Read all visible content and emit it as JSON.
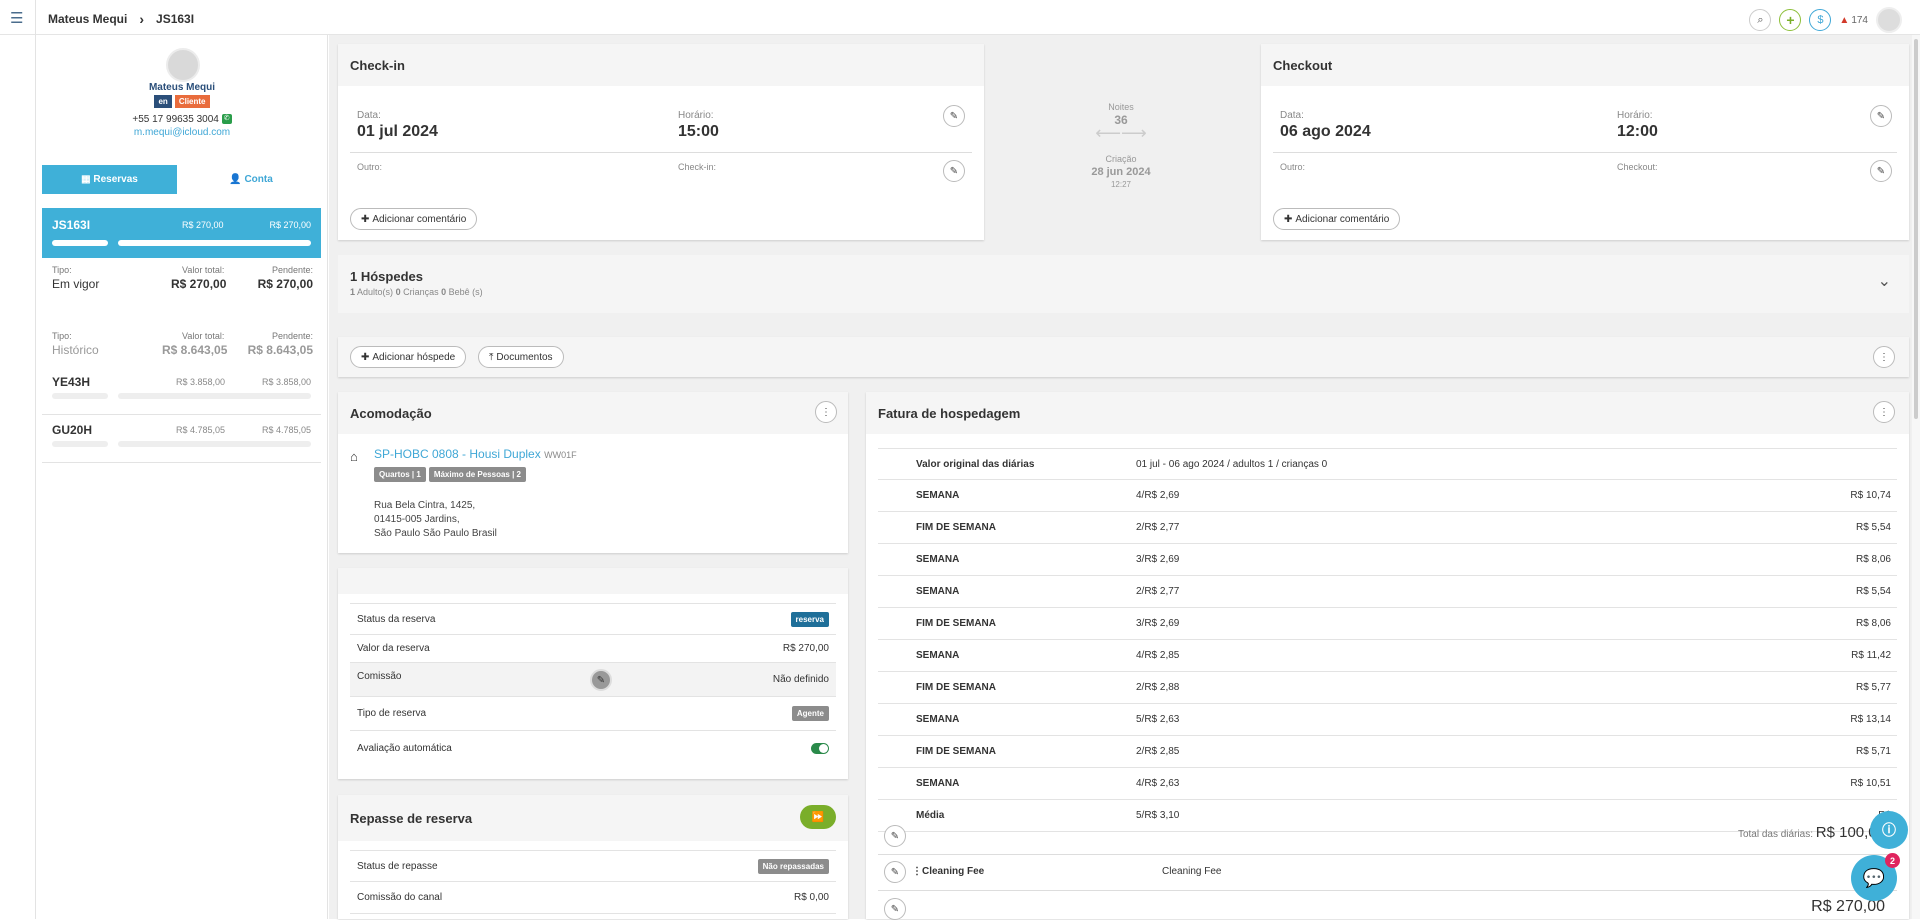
{
  "header": {
    "breadcrumb": [
      "Mateus Mequi",
      "JS163I"
    ],
    "alerts_count": "174"
  },
  "profile": {
    "name": "Mateus Mequi",
    "tags": [
      "en",
      "Cliente"
    ],
    "phone": "+55 17 99635 3004",
    "email": "m.mequi@icloud.com"
  },
  "tabs": {
    "reservas": "Reservas",
    "conta": "Conta"
  },
  "active_reservation": {
    "code": "JS163I",
    "value1": "R$ 270,00",
    "value2": "R$ 270,00",
    "progress1": 1,
    "progress2": 1
  },
  "summary_current": {
    "type_label": "Tipo:",
    "type": "Em vigor",
    "total_label": "Valor total:",
    "total": "R$ 270,00",
    "pending_label": "Pendente:",
    "pending": "R$ 270,00"
  },
  "summary_history": {
    "type_label": "Tipo:",
    "type": "Histórico",
    "total_label": "Valor total:",
    "total": "R$ 8.643,05",
    "pending_label": "Pendente:",
    "pending": "R$ 8.643,05"
  },
  "history_items": [
    {
      "code": "YE43H",
      "value1": "R$ 3.858,00",
      "value2": "R$ 3.858,00"
    },
    {
      "code": "GU20H",
      "value1": "R$ 4.785,05",
      "value2": "R$ 4.785,05"
    }
  ],
  "checkin": {
    "title": "Check-in",
    "date_label": "Data:",
    "date": "01 jul 2024",
    "time_label": "Horário:",
    "time": "15:00",
    "other_label": "Outro:",
    "field_label": "Check-in:",
    "comment_btn": "Adicionar comentário"
  },
  "middle": {
    "nights_label": "Noites",
    "nights": "36",
    "created_label": "Criação",
    "created_date": "28 jun 2024",
    "created_time": "12:27"
  },
  "checkout": {
    "title": "Checkout",
    "date_label": "Data:",
    "date": "06 ago 2024",
    "time_label": "Horário:",
    "time": "12:00",
    "other_label": "Outro:",
    "field_label": "Checkout:",
    "comment_btn": "Adicionar comentário"
  },
  "guests": {
    "title": "1 Hóspedes",
    "adults": "1",
    "adults_label": "Adulto(s)",
    "children": "0",
    "children_label": "Crianças",
    "babies": "0",
    "babies_label": "Bebê (s)",
    "add_btn": "Adicionar hóspede",
    "docs_btn": "Documentos"
  },
  "accommodation": {
    "title": "Acomodação",
    "name": "SP-HOBC 0808 - Housi Duplex",
    "code": "WW01F",
    "tags": [
      "Quartos | 1",
      "Máximo de Pessoas | 2"
    ],
    "address1": "Rua Bela Cintra, 1425,",
    "address2": "01415-005 Jardins,",
    "address3": "São Paulo São Paulo Brasil"
  },
  "details": {
    "status_label": "Status da reserva",
    "status": "reserva",
    "value_label": "Valor da reserva",
    "value": "R$ 270,00",
    "commission_label": "Comissão",
    "commission": "Não definido",
    "type_label": "Tipo de reserva",
    "type": "Agente",
    "auto_label": "Avaliação automática",
    "auto_on": true
  },
  "transfer": {
    "title": "Repasse de reserva",
    "status_label": "Status de repasse",
    "status": "Não repassadas",
    "channel_label": "Comissão do canal",
    "channel": "R$ 0,00"
  },
  "invoice": {
    "title": "Fatura de hospedagem",
    "header_label": "Valor original das diárias",
    "header_value": "01 jul - 06 ago 2024  /  adultos 1 /  crianças 0",
    "rows": [
      {
        "label": "SEMANA",
        "qty": "4/R$ 2,69",
        "total": "R$ 10,74"
      },
      {
        "label": "FIM DE SEMANA",
        "qty": "2/R$ 2,77",
        "total": "R$ 5,54"
      },
      {
        "label": "SEMANA",
        "qty": "3/R$ 2,69",
        "total": "R$ 8,06"
      },
      {
        "label": "SEMANA",
        "qty": "2/R$ 2,77",
        "total": "R$ 5,54"
      },
      {
        "label": "FIM DE SEMANA",
        "qty": "3/R$ 2,69",
        "total": "R$ 8,06"
      },
      {
        "label": "SEMANA",
        "qty": "4/R$ 2,85",
        "total": "R$ 11,42"
      },
      {
        "label": "FIM DE SEMANA",
        "qty": "2/R$ 2,88",
        "total": "R$ 5,77"
      },
      {
        "label": "SEMANA",
        "qty": "5/R$ 2,63",
        "total": "R$ 13,14"
      },
      {
        "label": "FIM DE SEMANA",
        "qty": "2/R$ 2,85",
        "total": "R$ 5,71"
      },
      {
        "label": "SEMANA",
        "qty": "4/R$ 2,63",
        "total": "R$ 10,51"
      },
      {
        "label": "Média",
        "qty": "5/R$ 3,10",
        "total": "R$"
      }
    ],
    "total_label": "Total das diárias:",
    "total_value": "R$ 100,00",
    "fee_label": "Cleaning Fee",
    "fee_desc": "Cleaning Fee",
    "fee_value": "R$",
    "bottom_value": "R$ 270,00"
  },
  "chat_badge": "2",
  "colors": {
    "accent": "#3fb0d8",
    "status_badge": "#1f6f99",
    "grey_badge": "#8c8c8c",
    "green": "#8dbf3a"
  }
}
